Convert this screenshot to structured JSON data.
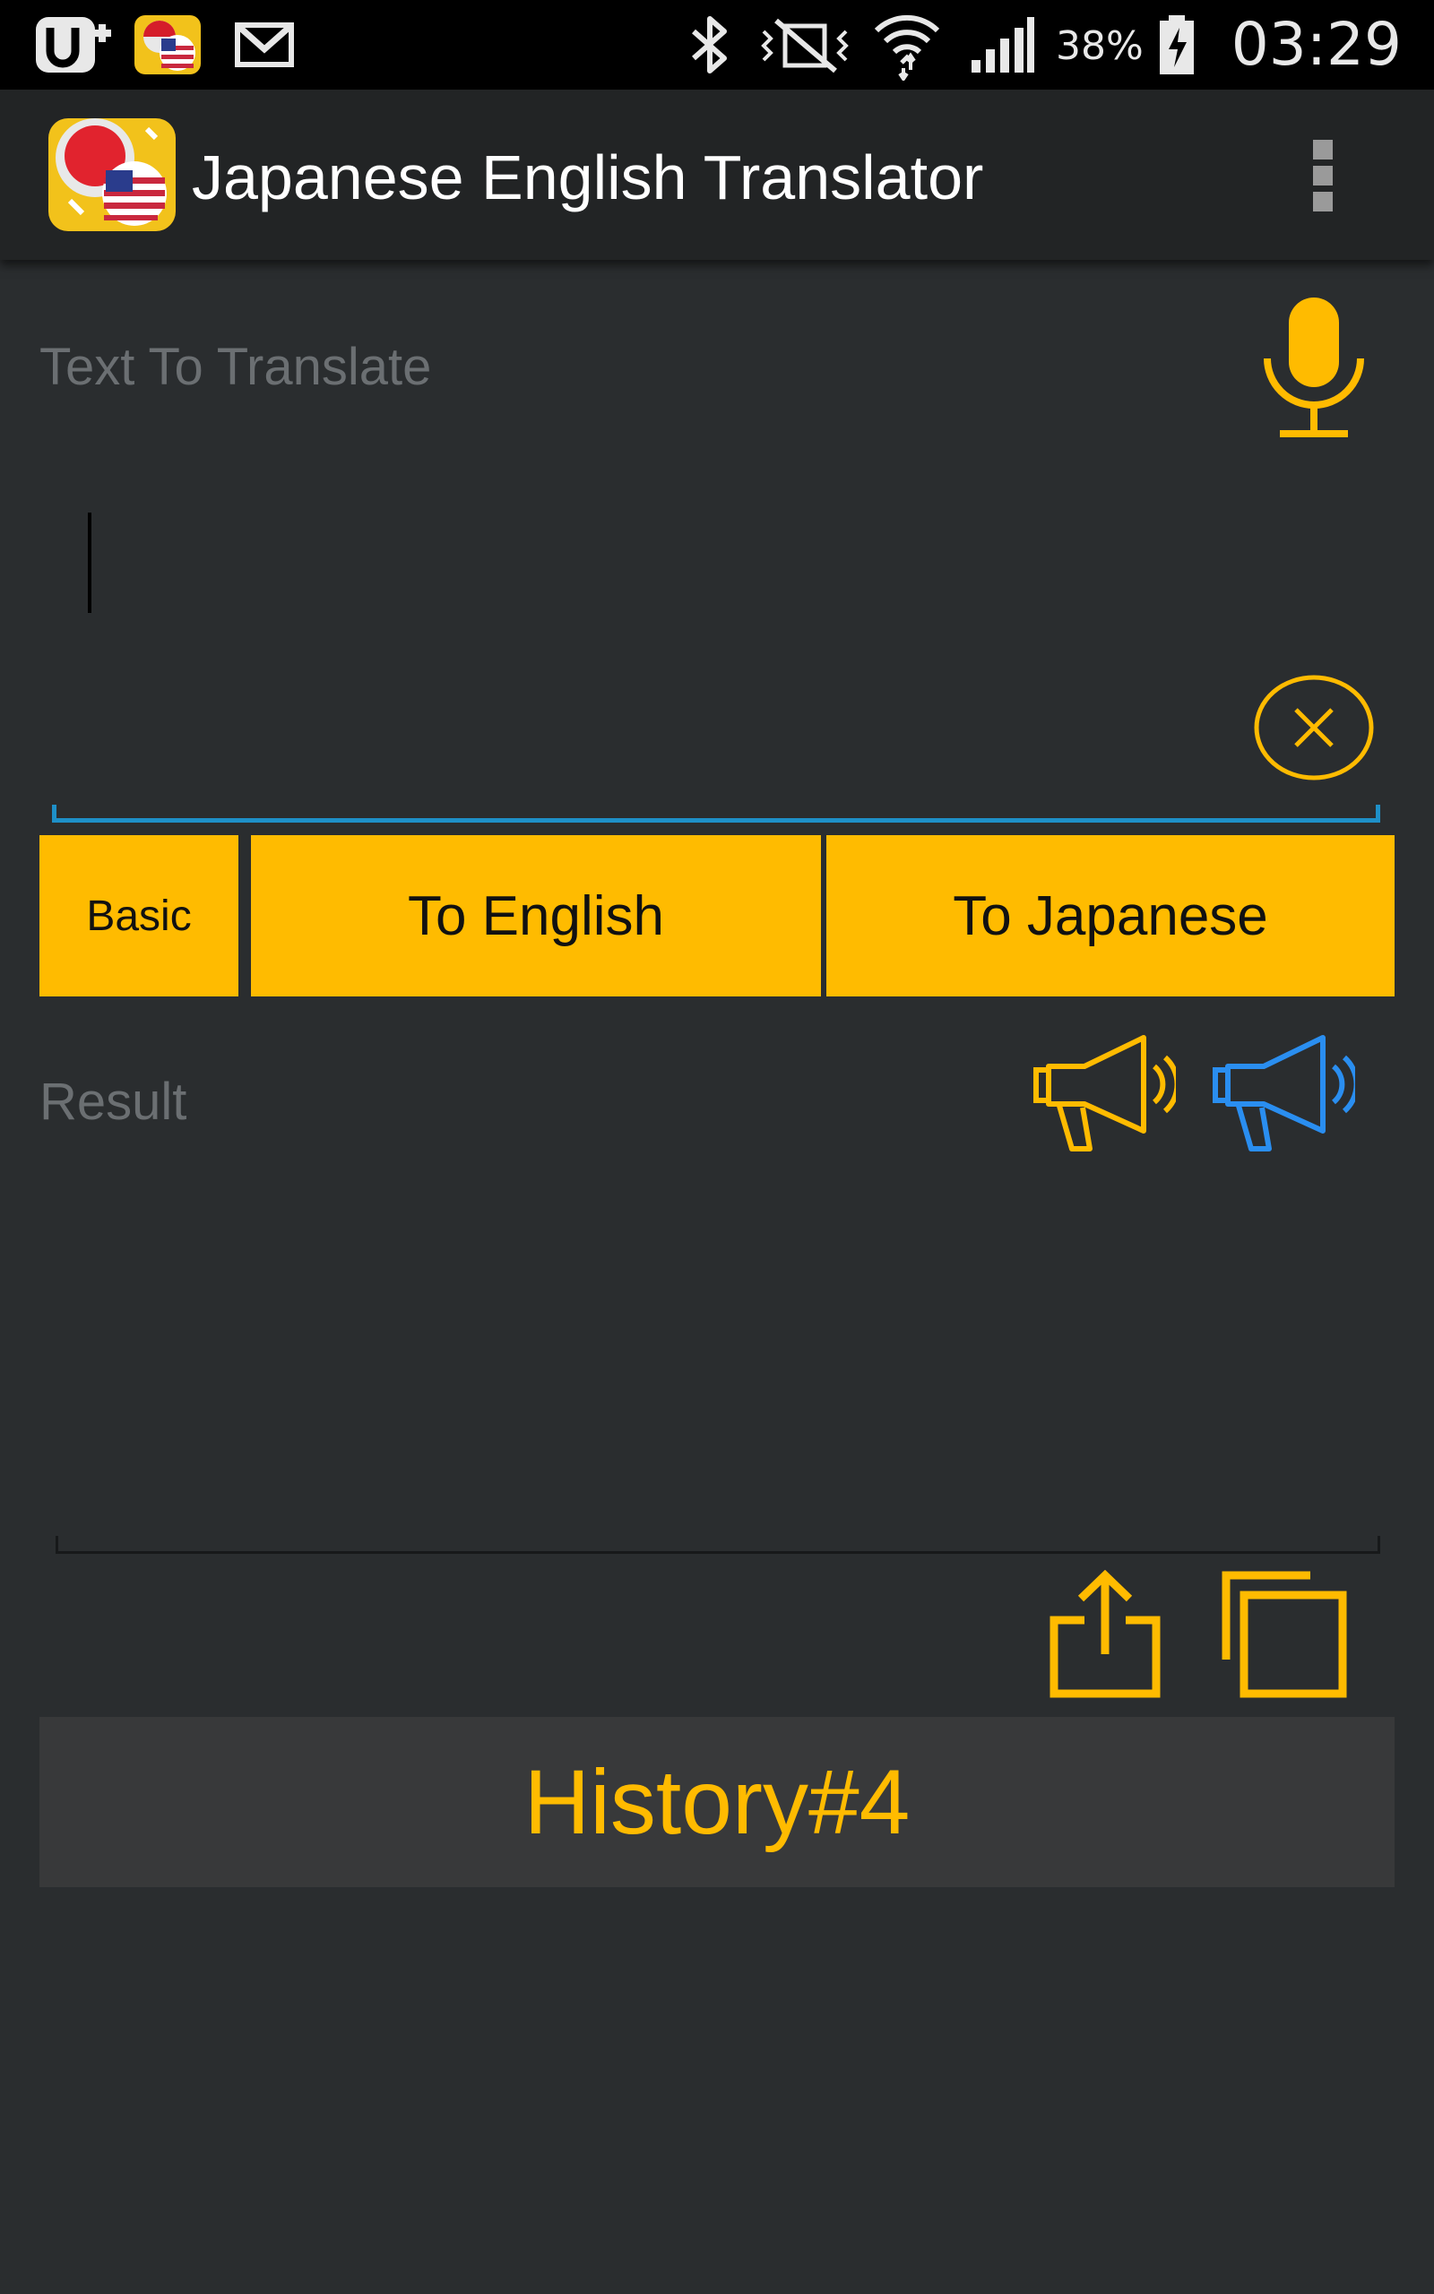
{
  "status_bar": {
    "battery_percent": "38%",
    "time": "03:29",
    "icons": [
      "uplus-icon",
      "app-notification-icon",
      "gmail-icon",
      "bluetooth-icon",
      "vibrate-icon",
      "wifi-icon",
      "signal-icon",
      "battery-charging-icon"
    ]
  },
  "app_bar": {
    "title": "Japanese English Translator",
    "logo": "app-logo-icon",
    "menu": "overflow-menu-icon"
  },
  "input": {
    "label": "Text To Translate",
    "value": "",
    "mic": "microphone-icon",
    "clear": "clear-icon"
  },
  "buttons": {
    "basic": "Basic",
    "to_english": "To English",
    "to_japanese": "To Japanese"
  },
  "result": {
    "label": "Result",
    "value": "",
    "speak_english": "megaphone-icon",
    "speak_japanese": "megaphone-icon",
    "share": "share-icon",
    "copy": "copy-icon"
  },
  "history": {
    "label": "History#4"
  },
  "colors": {
    "accent": "#ffbb00",
    "blue": "#2a8ef0",
    "background": "#2a2d2f",
    "appbar": "#222425"
  }
}
